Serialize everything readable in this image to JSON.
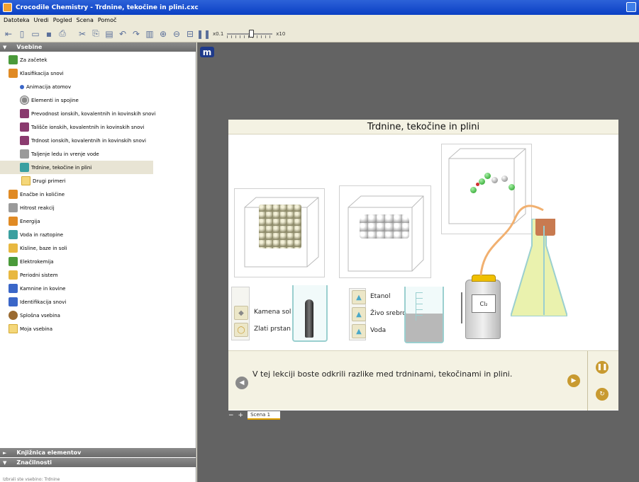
{
  "window": {
    "title": "Crocodile Chemistry - Trdnine, tekočine in plini.cxc"
  },
  "menu": [
    "Datoteka",
    "Uredi",
    "Pogled",
    "Scena",
    "Pomoč"
  ],
  "toolbar": {
    "speed_min": "x0.1",
    "speed_max": "x10",
    "speed_level": 0.55
  },
  "sidebar": {
    "header": "Vsebine",
    "items": [
      {
        "label": "Za začetek",
        "icon": "getting-started-icon"
      },
      {
        "label": "Klasifikacija snovi",
        "icon": "classification-icon"
      },
      {
        "label": "Animacija atomov",
        "icon": "atom-animation-icon"
      },
      {
        "label": "Elementi in spojine",
        "icon": "elements-icon"
      },
      {
        "label": "Prevodnost ionskih, kovalentnih in kovinskih snovi",
        "icon": "conductivity-icon"
      },
      {
        "label": "Tališče ionskih, kovalentnih in kovinskih snovi",
        "icon": "melting-point-icon"
      },
      {
        "label": "Trdnost ionskih, kovalentnih in kovinskih snovi",
        "icon": "strength-icon"
      },
      {
        "label": "Taljenje ledu in vrenje vode",
        "icon": "melting-ice-icon"
      },
      {
        "label": "Trdnine, tekočine in plini",
        "icon": "states-of-matter-icon"
      },
      {
        "label": "Drugi primeri",
        "icon": "folder-icon"
      },
      {
        "label": "Enačbe in količine",
        "icon": "equations-icon"
      },
      {
        "label": "Hitrost reakcij",
        "icon": "reaction-rate-icon"
      },
      {
        "label": "Energija",
        "icon": "energy-icon"
      },
      {
        "label": "Voda in raztopine",
        "icon": "water-icon"
      },
      {
        "label": "Kisline, baze in soli",
        "icon": "acids-icon"
      },
      {
        "label": "Elektrokemija",
        "icon": "electrochemistry-icon"
      },
      {
        "label": "Periodni sistem",
        "icon": "periodic-table-icon"
      },
      {
        "label": "Kamnine in kovine",
        "icon": "rocks-icon"
      },
      {
        "label": "Identifikacija snovi",
        "icon": "identification-icon"
      },
      {
        "label": "Splošna vsebina",
        "icon": "general-icon"
      },
      {
        "label": "Moja vsebina",
        "icon": "folder-icon"
      }
    ],
    "bottom_panels": [
      "Knjižnica elementov",
      "Značilnosti"
    ],
    "status": "Izbrali ste vsebino: Trdnine"
  },
  "scene": {
    "title": "Trdnine, tekočine in plini",
    "solid_options": [
      "Kamena sol",
      "Zlati prstan"
    ],
    "liquid_options": [
      "Etanol",
      "Živo srebro",
      "Voda"
    ],
    "gas_label": "Cl₂",
    "caption": "V tej lekciji boste odkrili razlike med trdninami, tekočinami in plini.",
    "tab": "Scena 1"
  }
}
